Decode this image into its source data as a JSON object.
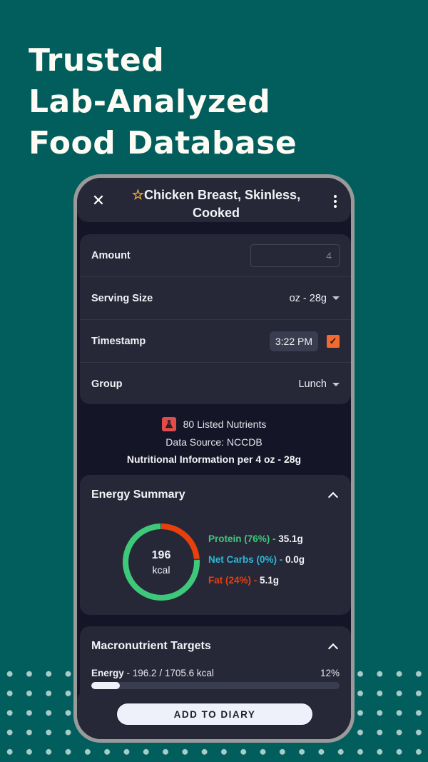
{
  "headline": [
    "Trusted",
    "Lab-Analyzed",
    "Food Database"
  ],
  "header": {
    "title": "Chicken Breast, Skinless, Cooked",
    "close_icon": "close-icon",
    "favorite_icon": "star-outline-icon",
    "menu_icon": "more-vertical-icon"
  },
  "form": {
    "amount": {
      "label": "Amount",
      "value": "4"
    },
    "serving_size": {
      "label": "Serving Size",
      "value": "oz - 28g"
    },
    "timestamp": {
      "label": "Timestamp",
      "value": "3:22 PM",
      "checked": true
    },
    "group": {
      "label": "Group",
      "value": "Lunch"
    }
  },
  "info": {
    "nutrients": "80 Listed Nutrients",
    "source": "Data Source: NCCDB",
    "per": "Nutritional Information per 4 oz - 28g"
  },
  "energy_summary": {
    "title": "Energy Summary",
    "kcal": "196",
    "unit": "kcal",
    "macros": [
      {
        "label": "Protein (76%)",
        "value": "35.1g",
        "percent": 76,
        "color": "#3ec97a"
      },
      {
        "label": "Net Carbs (0%)",
        "value": "0.0g",
        "percent": 0,
        "color": "#2bb7d6"
      },
      {
        "label": "Fat (24%)",
        "value": "5.1g",
        "percent": 24,
        "color": "#e8400c"
      }
    ]
  },
  "macro_targets": {
    "title": "Macronutrient Targets",
    "energy_label": "Energy",
    "energy_value": "196.2 / 1705.6 kcal",
    "percent_label": "12%",
    "progress": 0.115
  },
  "add_button": "ADD TO DIARY",
  "colors": {
    "background": "#015e5c",
    "accent_orange": "#f26a2e",
    "card": "#262838"
  }
}
